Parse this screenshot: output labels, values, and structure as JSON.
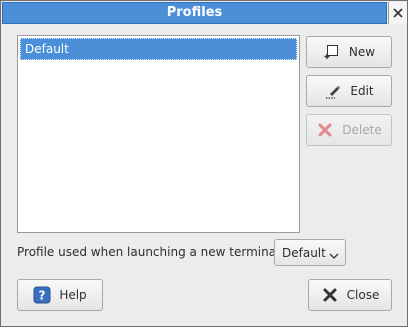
{
  "window": {
    "title": "Profiles"
  },
  "profiles": {
    "items": [
      "Default"
    ],
    "selected": "Default"
  },
  "buttons": {
    "new": {
      "label": "New",
      "icon": "new-document-icon"
    },
    "edit": {
      "label": "Edit",
      "icon": "pen-edit-icon"
    },
    "delete": {
      "label": "Delete",
      "icon": "delete-x-icon"
    },
    "help": {
      "label": "Help",
      "icon": "help-question-icon"
    },
    "close": {
      "label": "Close",
      "icon": "close-x-icon"
    }
  },
  "launch": {
    "label": "Profile used when launching a new terminal:",
    "selected": "Default"
  },
  "colors": {
    "accent": "#4b8fd8",
    "delete_icon": "#e08a8a",
    "help_icon": "#3a6fc0"
  }
}
